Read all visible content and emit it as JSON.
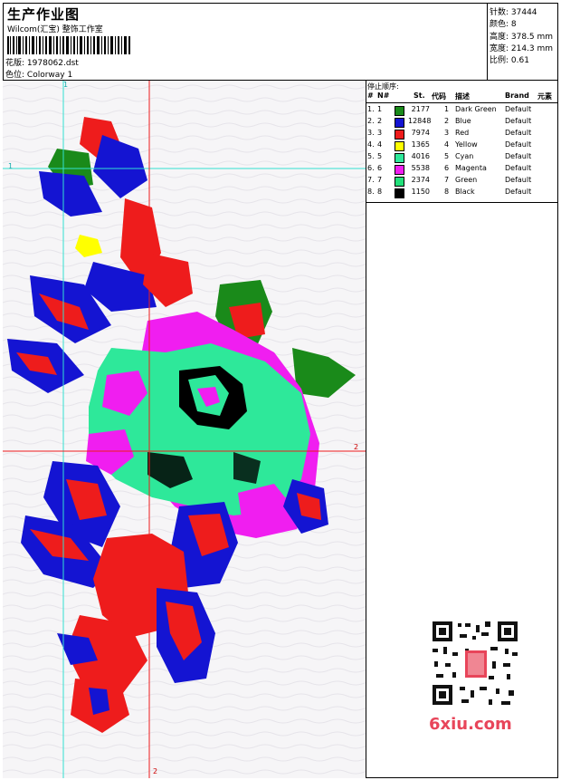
{
  "header": {
    "title": "生产作业图",
    "subtitle": "Wilcom(汇宝) 整饰工作室",
    "pattern_label": "花版:",
    "pattern_value": "1978062.dst",
    "colorway_label": "色位:",
    "colorway_value": "Colorway 1"
  },
  "stats": {
    "stitches": "针数: 37444",
    "colors": "颜色: 8",
    "height": "高度: 378.5 mm",
    "width": "宽度: 214.3 mm",
    "scale": "比例: 0.61"
  },
  "guides": {
    "v1": "1",
    "h1": "1",
    "h2": "2",
    "v2": "2"
  },
  "table": {
    "title": "停止顺序:",
    "headers": {
      "num": "#",
      "n": "N#",
      "st": "St.",
      "code": "代码",
      "desc": "描述",
      "brand": "Brand",
      "elem": "元素"
    },
    "rows": [
      {
        "num": "1.",
        "n": "1",
        "color": "#1a8a1a",
        "st": "2177",
        "code": "1",
        "desc": "Dark Green",
        "brand": "Default"
      },
      {
        "num": "2.",
        "n": "2",
        "color": "#1414d2",
        "st": "12848",
        "code": "2",
        "desc": "Blue",
        "brand": "Default"
      },
      {
        "num": "3.",
        "n": "3",
        "color": "#ee1c1c",
        "st": "7974",
        "code": "3",
        "desc": "Red",
        "brand": "Default"
      },
      {
        "num": "4.",
        "n": "4",
        "color": "#ffff00",
        "st": "1365",
        "code": "4",
        "desc": "Yellow",
        "brand": "Default"
      },
      {
        "num": "5.",
        "n": "5",
        "color": "#2ee89a",
        "st": "4016",
        "code": "5",
        "desc": "Cyan",
        "brand": "Default"
      },
      {
        "num": "6.",
        "n": "6",
        "color": "#f01ef0",
        "st": "5538",
        "code": "6",
        "desc": "Magenta",
        "brand": "Default"
      },
      {
        "num": "7.",
        "n": "7",
        "color": "#22e07a",
        "st": "2374",
        "code": "7",
        "desc": "Green",
        "brand": "Default"
      },
      {
        "num": "8.",
        "n": "8",
        "color": "#000000",
        "st": "1150",
        "code": "8",
        "desc": "Black",
        "brand": "Default"
      }
    ]
  },
  "watermark": "6xiu.com"
}
